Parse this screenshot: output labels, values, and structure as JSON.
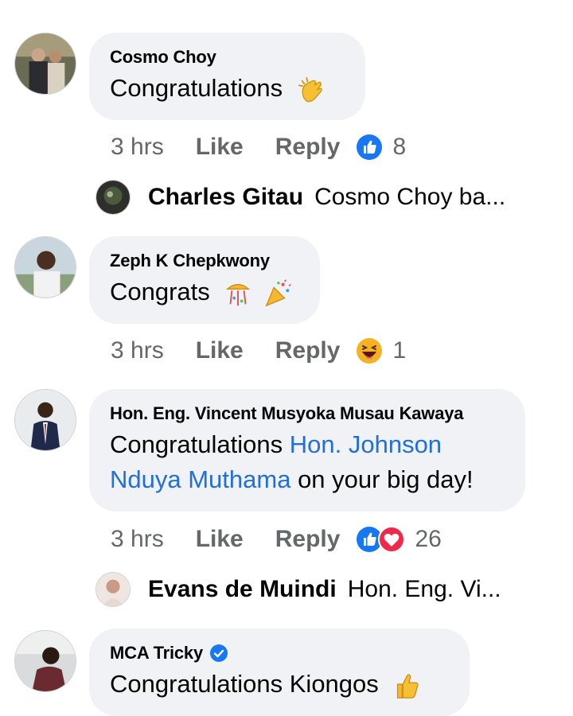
{
  "comments": [
    {
      "author": "Cosmo Choy",
      "text": "Congratulations",
      "emoji": "clapping-hands",
      "time": "3 hrs",
      "like_label": "Like",
      "reply_label": "Reply",
      "reactions": [
        "like-reaction"
      ],
      "reaction_count": "8",
      "reply_preview": {
        "name": "Charles Gitau",
        "text": "Cosmo Choy  ba..."
      }
    },
    {
      "author": "Zeph K Chepkwony",
      "text": "Congrats",
      "emoji": "confetti-ball-party-popper",
      "time": "3 hrs",
      "like_label": "Like",
      "reply_label": "Reply",
      "reactions": [
        "haha-reaction"
      ],
      "reaction_count": "1"
    },
    {
      "author": "Hon. Eng. Vincent Musyoka Musau Kawaya",
      "text_before": "Congratulations ",
      "mention": "Hon. Johnson Nduya Muthama",
      "text_after": " on your big day!",
      "time": "3 hrs",
      "like_label": "Like",
      "reply_label": "Reply",
      "reactions": [
        "like-reaction",
        "love-reaction"
      ],
      "reaction_count": "26",
      "reply_preview": {
        "name": "Evans de Muindi",
        "text": "Hon. Eng. Vi..."
      }
    },
    {
      "author": "MCA Tricky",
      "verified": true,
      "text": "Congratulations Kiongos",
      "emoji": "thumbs-up"
    }
  ],
  "colors": {
    "bubble": "#f0f2f5",
    "meta_text": "#65676b",
    "mention": "#216fdb",
    "like_blue": "#1877f2",
    "love_red": "#f02849",
    "haha_yellow": "#f7b125"
  }
}
